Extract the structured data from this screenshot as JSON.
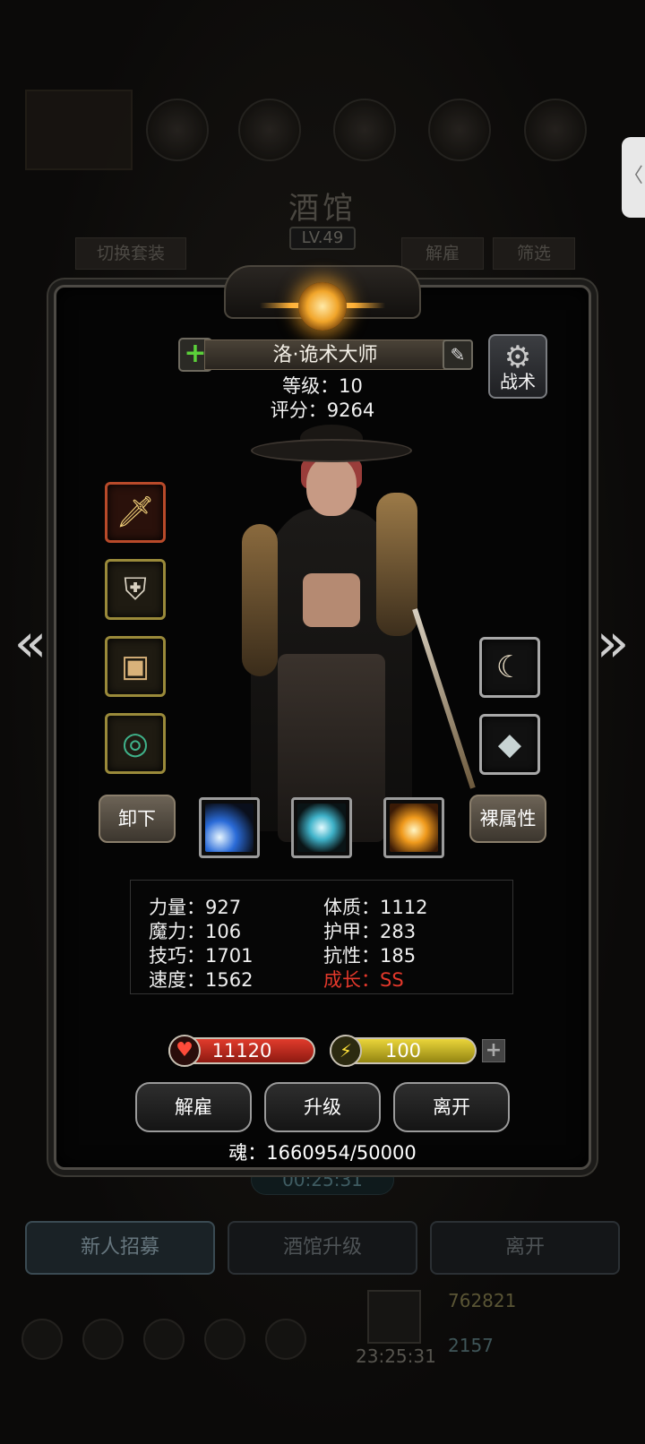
{
  "background": {
    "title": "酒馆",
    "level": "LV.49",
    "switch_outfit": "切换套装",
    "dismiss": "解雇",
    "filter": "筛选",
    "countdown": "00:25:31",
    "bottom_buttons": [
      "新人招募",
      "酒馆升级",
      "离开"
    ],
    "gold": "762821",
    "gems": "2157",
    "gift_timer": "23:25:31",
    "side_tab": "〈"
  },
  "hero": {
    "name": "洛·诡术大师",
    "level_line": "等级：10",
    "score_line": "评分：9264",
    "tactics_label": "战术"
  },
  "equipment": {
    "left": [
      {
        "icon": "dagger-icon",
        "glyph": "🗡",
        "rarity": "red"
      },
      {
        "icon": "helmet-icon",
        "glyph": "⛨",
        "rarity": "gold"
      },
      {
        "icon": "scroll-icon",
        "glyph": "▣",
        "rarity": "gold"
      },
      {
        "icon": "ring-icon",
        "glyph": "◎",
        "rarity": "gold"
      }
    ],
    "right": [
      {
        "icon": "claw-icon",
        "glyph": "☾",
        "rarity": "plain"
      },
      {
        "icon": "stone-icon",
        "glyph": "◆",
        "rarity": "plain"
      }
    ]
  },
  "buttons": {
    "unequip": "卸下",
    "base_stats": "裸属性",
    "dismiss": "解雇",
    "upgrade": "升级",
    "leave": "离开"
  },
  "skills": [
    {
      "icon": "light-beam-skill-icon",
      "color": "#2a6bd8"
    },
    {
      "icon": "wind-slash-skill-icon",
      "color": "#3fb2c9"
    },
    {
      "icon": "fire-burst-skill-icon",
      "color": "#f09a1c"
    }
  ],
  "stats": {
    "strength": "力量：927",
    "magic": "魔力：106",
    "skill": "技巧：1701",
    "speed": "速度：1562",
    "constitution": "体质：1112",
    "armor": "护甲：283",
    "resistance": "抗性：185",
    "growth": "成长：SS"
  },
  "hp": "11120",
  "energy": "100",
  "soul": "魂：1660954/50000",
  "colors": {
    "growth": "#e3382b",
    "hp": "#e13b2c",
    "energy": "#ead53a"
  }
}
